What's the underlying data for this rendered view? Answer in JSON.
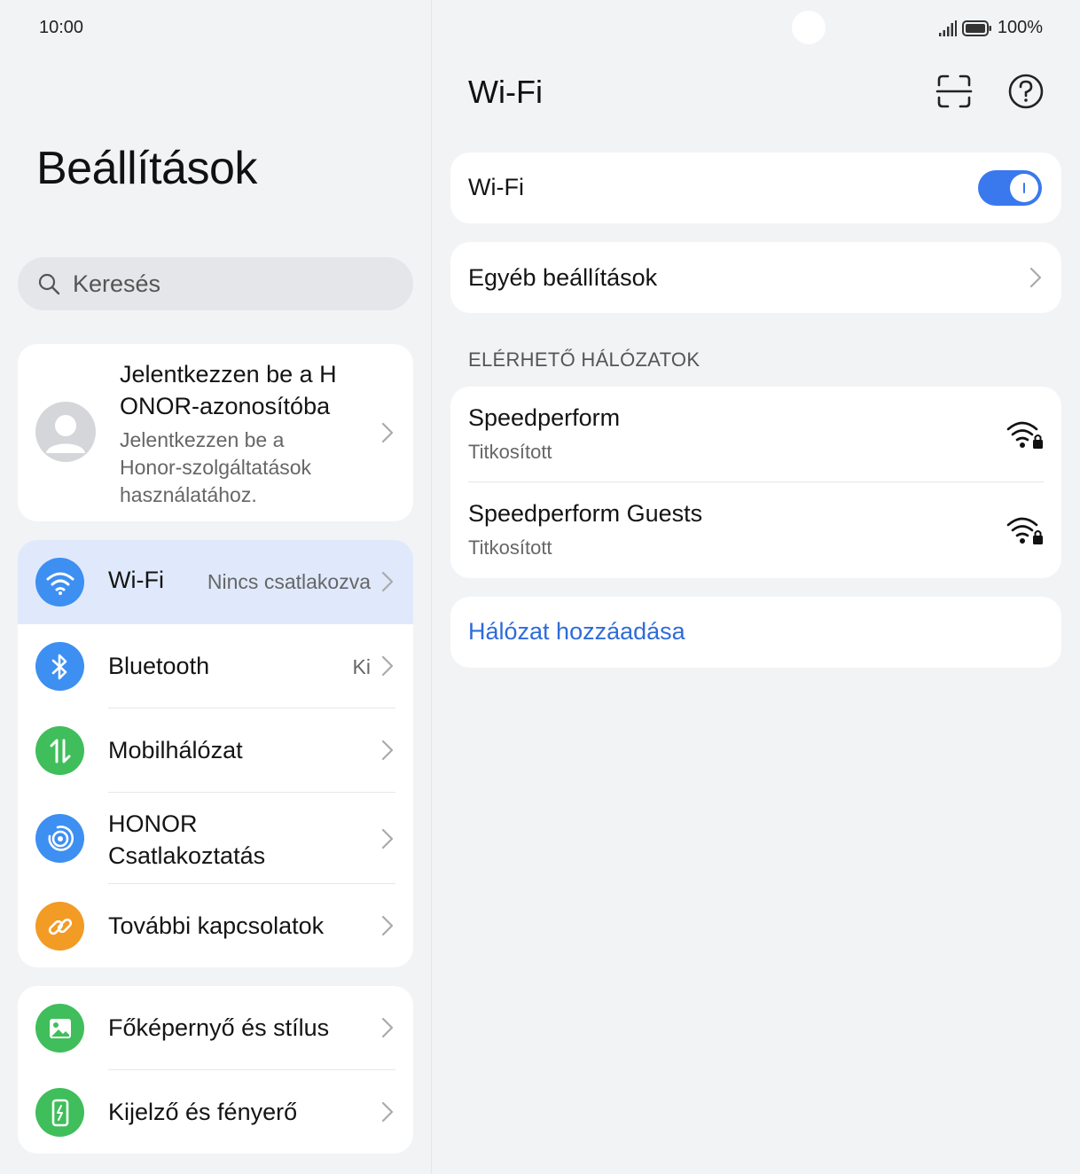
{
  "status_bar": {
    "time": "10:00",
    "battery": "100%"
  },
  "left": {
    "title": "Beállítások",
    "search_placeholder": "Keresés",
    "account": {
      "name": "Jelentkezzen be a HONOR-azonosítóba",
      "name_line1": "Jelentkezzen be a H",
      "name_line2": "ONOR-azonosítóba",
      "sub_line1": "Jelentkezzen be a",
      "sub_line2": "Honor-szolgáltatások",
      "sub_line3": "használatához."
    },
    "items": [
      {
        "id": "wifi",
        "label": "Wi-Fi",
        "value": "Nincs csatlakozva",
        "icon": "wifi-icon",
        "color": "#3d8ff2"
      },
      {
        "id": "bluetooth",
        "label": "Bluetooth",
        "value": "Ki",
        "icon": "bluetooth-icon",
        "color": "#3d8ff2"
      },
      {
        "id": "mobile",
        "label": "Mobilhálózat",
        "value": "",
        "icon": "mobile-data-icon",
        "color": "#3fbe5b"
      },
      {
        "id": "honor_connect",
        "label_line1": "HONOR",
        "label_line2": "Csatlakoztatás",
        "value": "",
        "icon": "honor-connect-icon",
        "color": "#3d8ff2"
      },
      {
        "id": "more",
        "label": "További kapcsolatok",
        "value": "",
        "icon": "link-icon",
        "color": "#f29b25"
      },
      {
        "id": "home",
        "label": "Főképernyő és stílus",
        "value": "",
        "icon": "wallpaper-icon",
        "color": "#3fbe5b"
      },
      {
        "id": "display",
        "label": "Kijelző és fényerő",
        "value": "",
        "icon": "display-icon",
        "color": "#3fbe5b"
      }
    ]
  },
  "right": {
    "title": "Wi-Fi",
    "wifi_toggle_label": "Wi-Fi",
    "wifi_enabled": true,
    "other_settings": "Egyéb beállítások",
    "available_header": "ELÉRHETŐ HÁLÓZATOK",
    "networks": [
      {
        "name": "Speedperform",
        "security": "Titkosított"
      },
      {
        "name": "Speedperform Guests",
        "security": "Titkosított"
      }
    ],
    "add_network": "Hálózat hozzáadása"
  },
  "colors": {
    "accent": "#3a78ee",
    "link": "#2e6bd9",
    "selected_row": "#dfe9fb",
    "background": "#f1f3f5"
  }
}
